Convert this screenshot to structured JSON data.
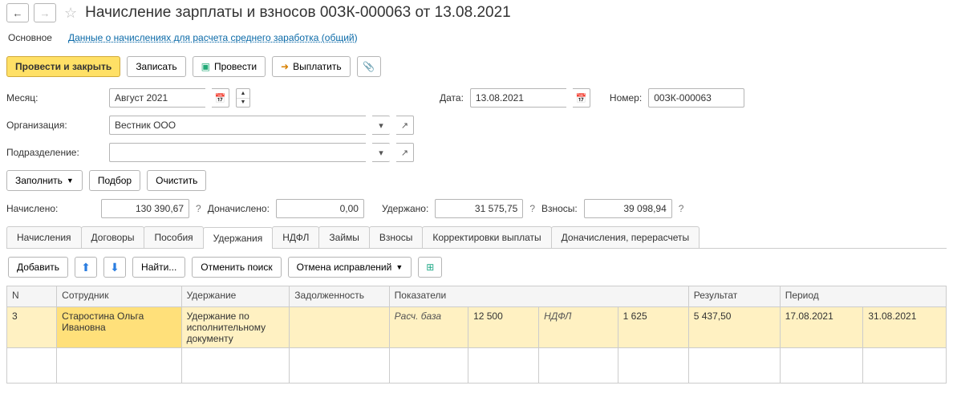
{
  "header": {
    "title": "Начисление зарплаты и взносов 00ЗК-000063 от 13.08.2021"
  },
  "nav": {
    "main": "Основное",
    "link": "Данные о начислениях для расчета среднего заработка (общий)"
  },
  "toolbar": {
    "post_close": "Провести и закрыть",
    "save": "Записать",
    "post": "Провести",
    "pay": "Выплатить"
  },
  "form": {
    "month_label": "Месяц:",
    "month_value": "Август 2021",
    "date_label": "Дата:",
    "date_value": "13.08.2021",
    "number_label": "Номер:",
    "number_value": "00ЗК-000063",
    "org_label": "Организация:",
    "org_value": "Вестник ООО",
    "dept_label": "Подразделение:",
    "dept_value": ""
  },
  "actions": {
    "fill": "Заполнить",
    "select": "Подбор",
    "clear": "Очистить"
  },
  "totals": {
    "accrued_label": "Начислено:",
    "accrued": "130 390,67",
    "addl_label": "Доначислено:",
    "addl": "0,00",
    "withheld_label": "Удержано:",
    "withheld": "31 575,75",
    "contrib_label": "Взносы:",
    "contrib": "39 098,94"
  },
  "tabs": [
    "Начисления",
    "Договоры",
    "Пособия",
    "Удержания",
    "НДФЛ",
    "Займы",
    "Взносы",
    "Корректировки выплаты",
    "Доначисления, перерасчеты"
  ],
  "active_tab": "Удержания",
  "sub_toolbar": {
    "add": "Добавить",
    "find": "Найти...",
    "cancel_search": "Отменить поиск",
    "cancel_fix": "Отмена исправлений"
  },
  "columns": {
    "n": "N",
    "employee": "Сотрудник",
    "deduction": "Удержание",
    "debt": "Задолженность",
    "indicators": "Показатели",
    "result": "Результат",
    "period": "Период"
  },
  "rows": [
    {
      "n": "3",
      "employee": "Старостина Ольга Ивановна",
      "deduction": "Удержание по исполнительному документу",
      "debt": "",
      "ind1_label": "Расч. база",
      "ind1_value": "12 500",
      "ind2_label": "НДФЛ",
      "ind2_value": "1 625",
      "result": "5 437,50",
      "period_from": "17.08.2021",
      "period_to": "31.08.2021"
    }
  ]
}
